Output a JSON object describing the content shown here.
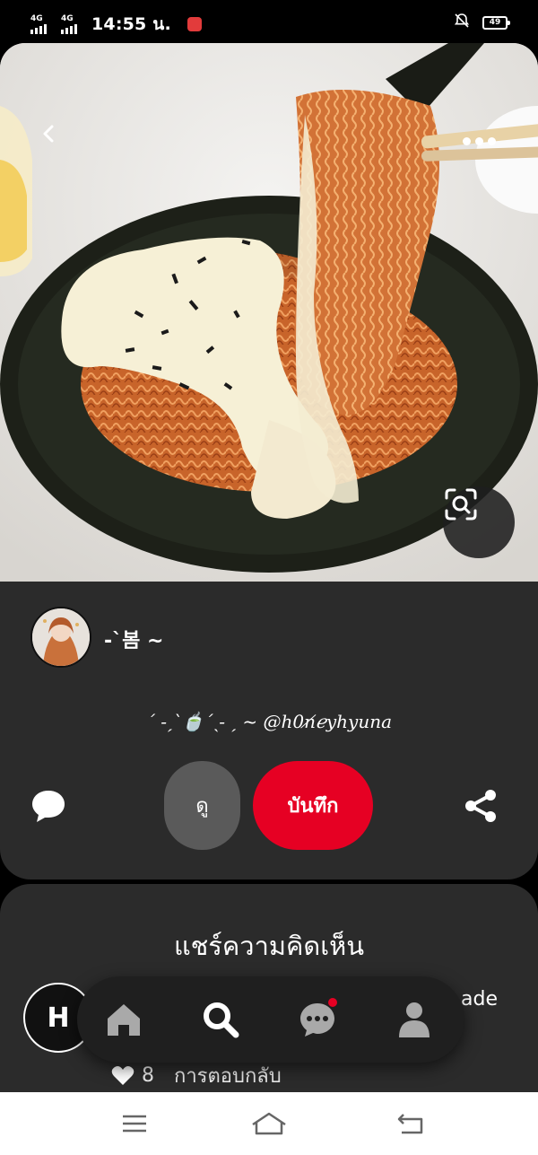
{
  "status_bar": {
    "network_1": "4G",
    "network_2": "4G",
    "time": "14:55 น.",
    "battery": "49",
    "icons": [
      "signal-icon",
      "signal-icon",
      "app-notification-icon",
      "alarm-off-icon",
      "battery-icon"
    ]
  },
  "pin": {
    "image_description_icon_names": [
      "back-arrow-icon",
      "more-dots-icon",
      "visual-search-icon"
    ],
    "author": "-ˋ봄 ~",
    "caption": "ˊ -ˏˋ🍵ˊˎ- ˏ ~ @h0n̸ℯyhyuna",
    "view_label": "ดู",
    "save_label": "บันทึก"
  },
  "comments": {
    "title": "แชร์ความคิดเห็น",
    "commenter_initial": "H",
    "comment_text_tail": "ade",
    "like_count": "8",
    "reply_label": "การตอบกลับ"
  },
  "nav": {
    "items": [
      "home-icon",
      "search-icon",
      "messages-icon",
      "profile-icon"
    ]
  },
  "colors": {
    "accent": "#e60023",
    "panel": "#2b2b2b",
    "background": "#000000"
  }
}
